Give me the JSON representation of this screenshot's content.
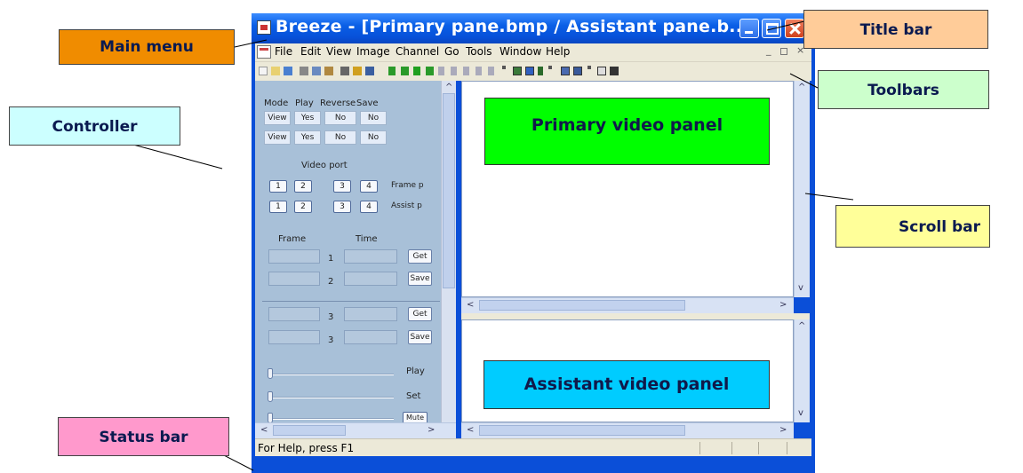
{
  "window": {
    "title": "Breeze - [Primary pane.bmp  /  Assistant pane.b...",
    "menu": [
      "File",
      "Edit",
      "View",
      "Image",
      "Channel",
      "Go",
      "Tools",
      "Window",
      "Help"
    ],
    "mdi_controls": [
      "_",
      "×"
    ]
  },
  "controller": {
    "headers": [
      "Mode",
      "Play",
      "Reverse",
      "Save"
    ],
    "row1": [
      "View",
      "Yes",
      "No",
      "No"
    ],
    "row2": [
      "View",
      "Yes",
      "No",
      "No"
    ],
    "video_port_label": "Video port",
    "port_buttons": [
      "1",
      "2",
      "3",
      "4"
    ],
    "frame_label": "Frame p",
    "assist_label": "Assist p",
    "col_frame": "Frame",
    "col_time": "Time",
    "rows": [
      {
        "num": "1",
        "button": "Get"
      },
      {
        "num": "2",
        "button": "Save"
      },
      {
        "num": "3",
        "button": "Get"
      },
      {
        "num": "3",
        "button": "Save"
      }
    ],
    "slider_labels": [
      "Play",
      "Set"
    ],
    "mute_label": "Mute"
  },
  "status": {
    "text": "For Help, press F1"
  },
  "callouts": {
    "main_menu": "Main menu",
    "controller": "Controller",
    "status_bar": "Status bar",
    "title_bar": "Title bar",
    "toolbars": "Toolbars",
    "scroll_bar": "Scroll bar",
    "primary_panel": "Primary video panel",
    "assistant_panel": "Assistant video panel"
  },
  "colors": {
    "main_menu": "#f08c00",
    "controller": "#ccffff",
    "status_bar": "#ff99cc",
    "title_bar": "#ffcc99",
    "toolbars": "#ccffcc",
    "scroll_bar": "#ffff99",
    "primary_panel": "#00ff00",
    "assistant_panel": "#00ccff"
  }
}
